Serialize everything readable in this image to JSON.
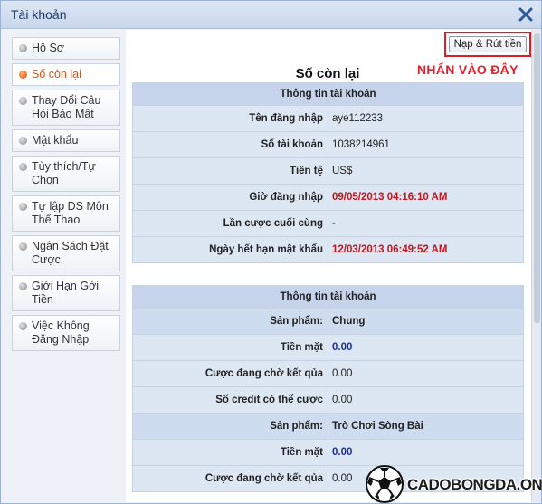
{
  "window": {
    "title": "Tài khoản"
  },
  "sidebar": {
    "items": [
      {
        "label": "Hồ Sơ",
        "active": false
      },
      {
        "label": "Số còn lại",
        "active": true
      },
      {
        "label": "Thay Đổi Câu Hỏi Bảo Mật",
        "active": false
      },
      {
        "label": "Mật khẩu",
        "active": false
      },
      {
        "label": "Tùy thích/Tự Chọn",
        "active": false
      },
      {
        "label": "Tự lập DS Môn Thể Thao",
        "active": false
      },
      {
        "label": "Ngân Sách Đặt Cược",
        "active": false
      },
      {
        "label": "Giới Hạn Gởi Tiền",
        "active": false
      },
      {
        "label": "Việc Không Đăng Nhập",
        "active": false
      }
    ]
  },
  "main": {
    "deposit_button": "Nạp & Rút tiền",
    "annotation": "NHẤN VÀO ĐÂY",
    "section_title": "Số còn lại",
    "account_info": {
      "header": "Thông tin tài khoản",
      "rows": [
        {
          "label": "Tên đăng nhập",
          "value": "aye112233"
        },
        {
          "label": "Số tài khoản",
          "value": "1038214961"
        },
        {
          "label": "Tiền tệ",
          "value": "US$"
        },
        {
          "label": "Giờ đăng nhập",
          "value": "09/05/2013 04:16:10 AM"
        },
        {
          "label": "Lần cược cuối cùng",
          "value": "-"
        },
        {
          "label": "Ngày hết hạn mật khẩu",
          "value": "12/03/2013 06:49:52 AM"
        }
      ]
    },
    "balance_info": {
      "header": "Thông tin tài khoản",
      "rows": [
        {
          "label": "Sản phẩm:",
          "value": "Chung"
        },
        {
          "label": "Tiền mặt",
          "value": "0.00"
        },
        {
          "label": "Cược đang chờ kết qủa",
          "value": "0.00"
        },
        {
          "label": "Số credit có thể cược",
          "value": "0.00"
        },
        {
          "label": "Sản phẩm:",
          "value": "Trò Chơi Sòng Bài"
        },
        {
          "label": "Tiền mặt",
          "value": "0.00"
        },
        {
          "label": "Cược đang chờ kết qủa",
          "value": "0.00"
        }
      ]
    }
  },
  "watermark": {
    "text": "CADOBONGDA.ONE"
  },
  "colors": {
    "accent_red": "#c0161d",
    "value_blue": "#1a2e9c",
    "active_orange": "#e05010",
    "table_header": "#c5d4ea",
    "table_cell": "#dde7f4"
  },
  "icons": {
    "close": "close-x-icon",
    "sidebar_bullet": "bullet-icon",
    "logo": "soccer-ball-icon"
  }
}
